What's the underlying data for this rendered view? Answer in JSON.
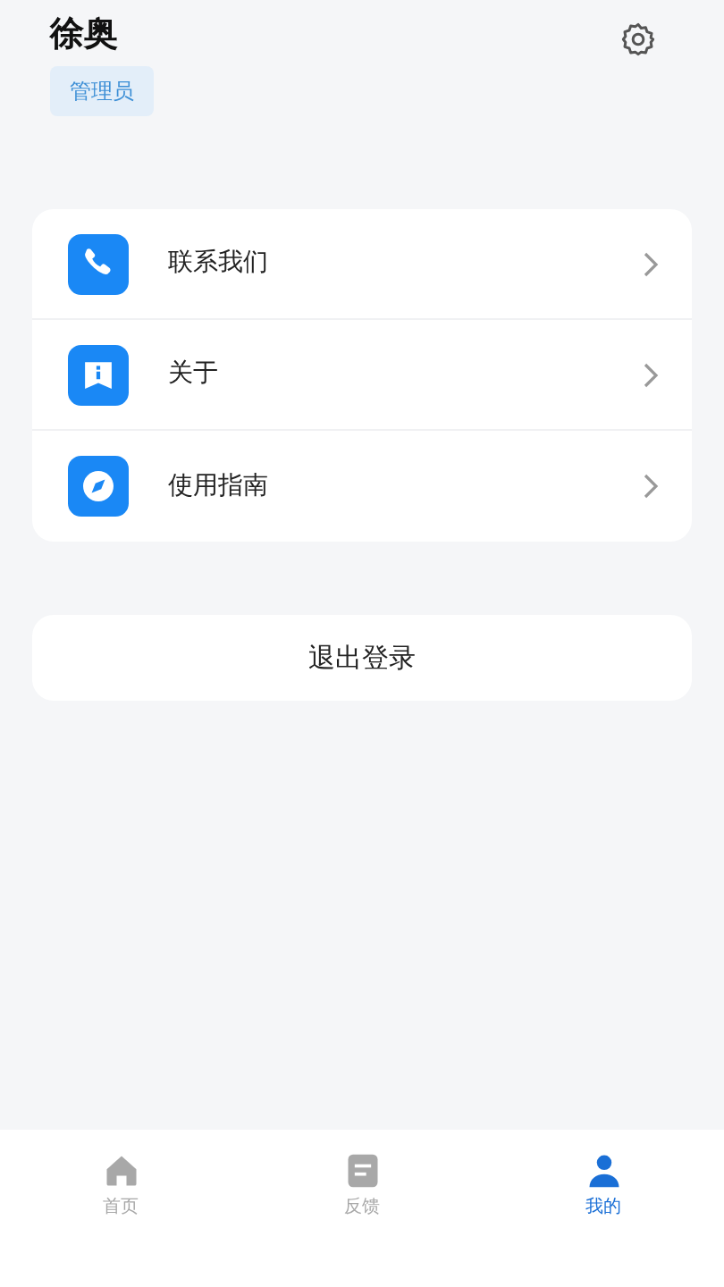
{
  "profile": {
    "name": "徐奥",
    "role": "管理员"
  },
  "menu": [
    {
      "kind": "phone",
      "label": "联系我们"
    },
    {
      "kind": "info",
      "label": "关于"
    },
    {
      "kind": "compass",
      "label": "使用指南"
    }
  ],
  "logout": "退出登录",
  "tabs": [
    {
      "kind": "home",
      "label": "首页",
      "selected": false
    },
    {
      "kind": "doc",
      "label": "反馈",
      "selected": false
    },
    {
      "kind": "person",
      "label": "我的",
      "selected": true
    }
  ]
}
